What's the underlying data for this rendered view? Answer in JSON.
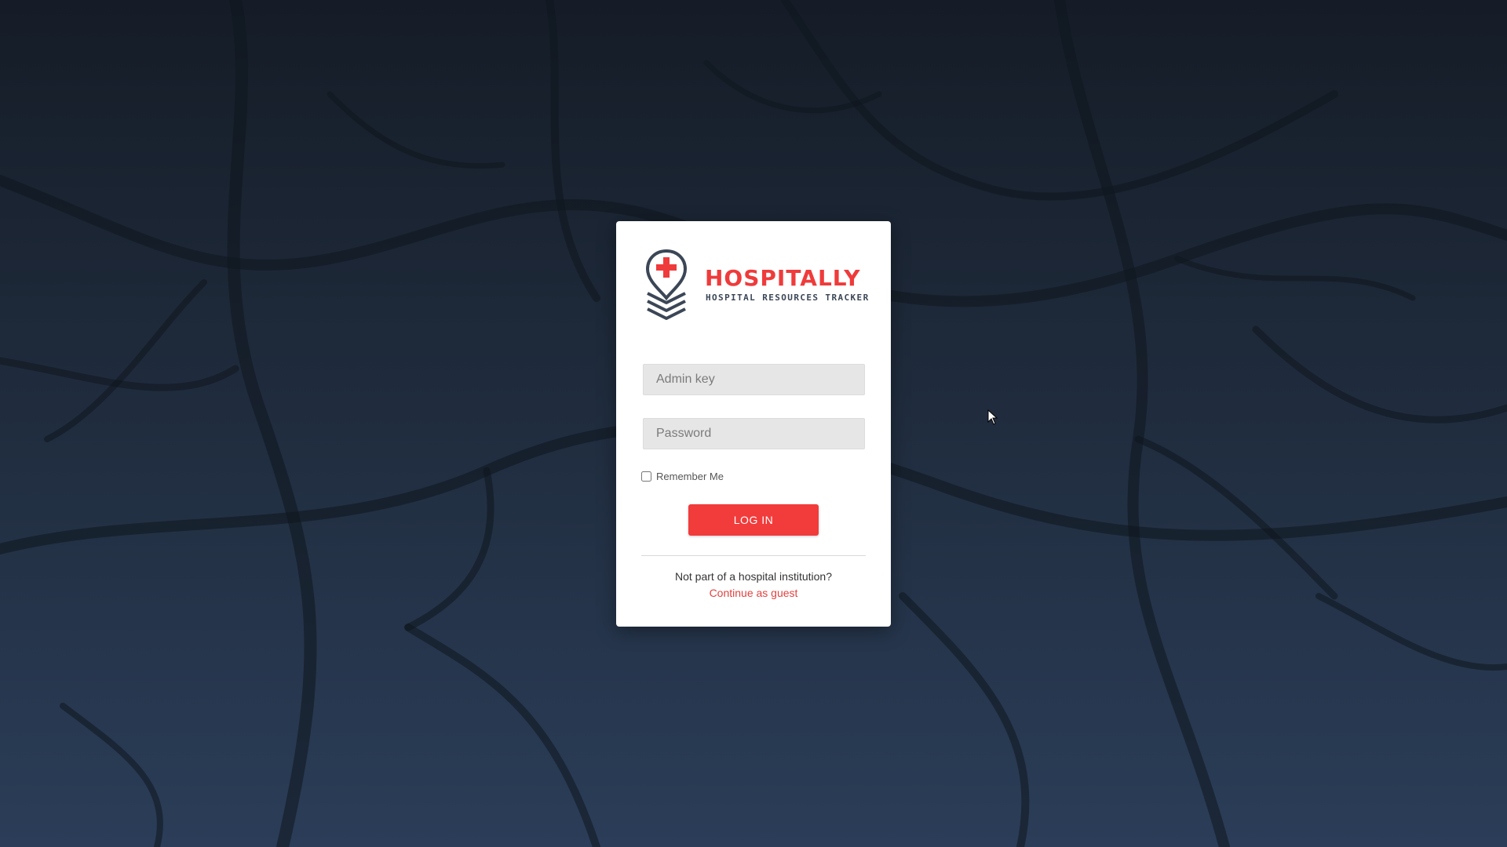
{
  "brand": {
    "name": "HOSPITALLY",
    "tagline": "HOSPITAL RESOURCES TRACKER"
  },
  "form": {
    "admin_key_placeholder": "Admin key",
    "admin_key_value": "",
    "password_placeholder": "Password",
    "password_value": "",
    "remember_label": "Remember Me",
    "remember_checked": false,
    "login_label": "LOG IN"
  },
  "guest": {
    "prompt": "Not part of a hospital institution?",
    "link_label": "Continue as guest"
  },
  "colors": {
    "accent": "#f23b3b",
    "brand_red": "#ef3b3b",
    "brand_dark": "#3b4656",
    "background_top": "#151c27",
    "background_bottom": "#2b3d58"
  },
  "icons": {
    "logo": "map-pin-cross-layers-icon",
    "cursor": "mouse-pointer-icon"
  }
}
